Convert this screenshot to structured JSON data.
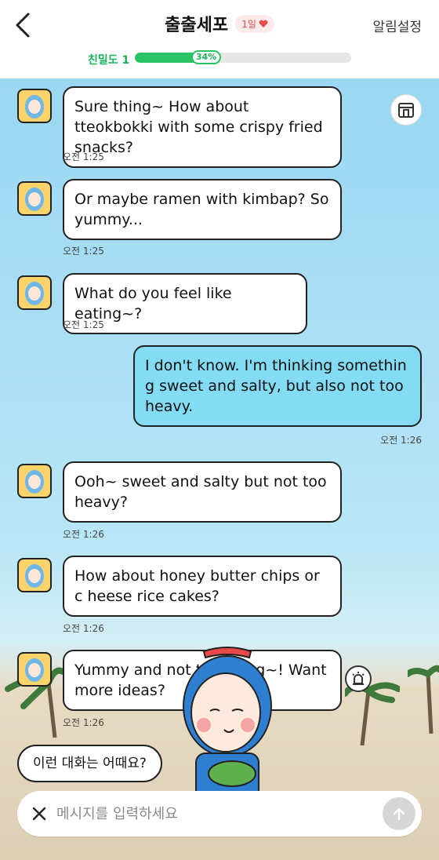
{
  "header": {
    "title": "출출세포",
    "day_badge": "1일",
    "settings_label": "알림설정",
    "bond_label": "친밀도 1",
    "bond_percent_text": "34%",
    "bond_progress": 0.34
  },
  "messages": [
    {
      "sender": "bot",
      "text": "Sure thing~ How about tteokbokki with some crispy fried snacks?",
      "time": "오전 1:25"
    },
    {
      "sender": "bot",
      "text": "Or maybe ramen with kimbap? So yummy...",
      "time": "오전 1:25"
    },
    {
      "sender": "bot",
      "text": "What do you feel like eating~?",
      "time": "오전 1:25"
    },
    {
      "sender": "user",
      "text": "I don't know. I'm thinking somethin g sweet and salty, but also not too heavy.",
      "time": "오전 1:26"
    },
    {
      "sender": "bot",
      "text": "Ooh~ sweet and salty but not too heavy?",
      "time": "오전 1:26"
    },
    {
      "sender": "bot",
      "text": "How about honey butter chips or c heese rice cakes?",
      "time": "오전 1:26"
    },
    {
      "sender": "bot",
      "text": "Yummy and not too filling~! Want more ideas?",
      "time": "오전 1:26"
    }
  ],
  "suggestion": "이런 대화는 어때요?",
  "input": {
    "placeholder": "메시지를 입력하세요",
    "value": ""
  },
  "colors": {
    "accent_green": "#28c466",
    "user_bubble": "#83dcf4",
    "badge_heart": "#e24c4c"
  },
  "icons": {
    "back": "chevron-left-icon",
    "store": "store-icon",
    "alert": "alarm-icon",
    "close": "close-icon",
    "send": "arrow-up-icon",
    "heart": "heart-icon"
  }
}
